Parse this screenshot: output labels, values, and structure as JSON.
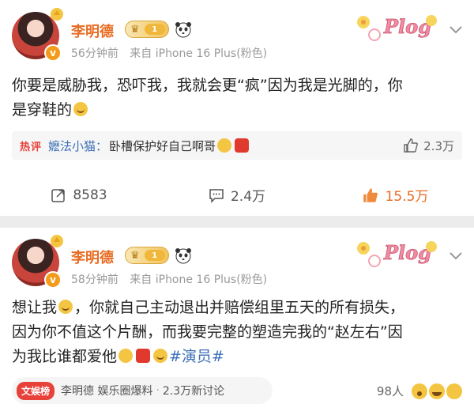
{
  "posts": [
    {
      "username": "李明德",
      "vip_level": "1",
      "time": "56分钟前",
      "source": "来自 iPhone 16 Plus(粉色)",
      "text_line1": "你要是威胁我，恐吓我，我就会更“疯”因为我是光脚的，你",
      "text_line2": "是穿鞋的",
      "hot_badge": "热评",
      "commenter": "嬷法小猫：",
      "comment_text": "卧槽保护好自己啊哥",
      "comment_likes": "2.3万",
      "reposts": "8583",
      "comments": "2.4万",
      "likes": "15.5万"
    },
    {
      "username": "李明德",
      "vip_level": "1",
      "time": "58分钟前",
      "source": "来自 iPhone 16 Plus(粉色)",
      "text_line1a": "想让我",
      "text_line1b": "，你就自己主动退出并赔偿组里五天的所有损失，",
      "text_line2": "因为你不值这个片酬，而我要完整的塑造完我的“赵左右”因",
      "text_line3": "为我比谁都爱他",
      "hashtag": "#演员#",
      "topic_badge": "文娱榜",
      "topic_name": "李明德",
      "topic_category": "娱乐圈爆料",
      "topic_discussion": "2.3万新讨论",
      "reaction_count": "98人"
    }
  ],
  "decor_text": "Plog",
  "colors": {
    "accent_orange": "#e86c23",
    "link_blue": "#3b6fb6",
    "hot_red": "#e8413a"
  }
}
